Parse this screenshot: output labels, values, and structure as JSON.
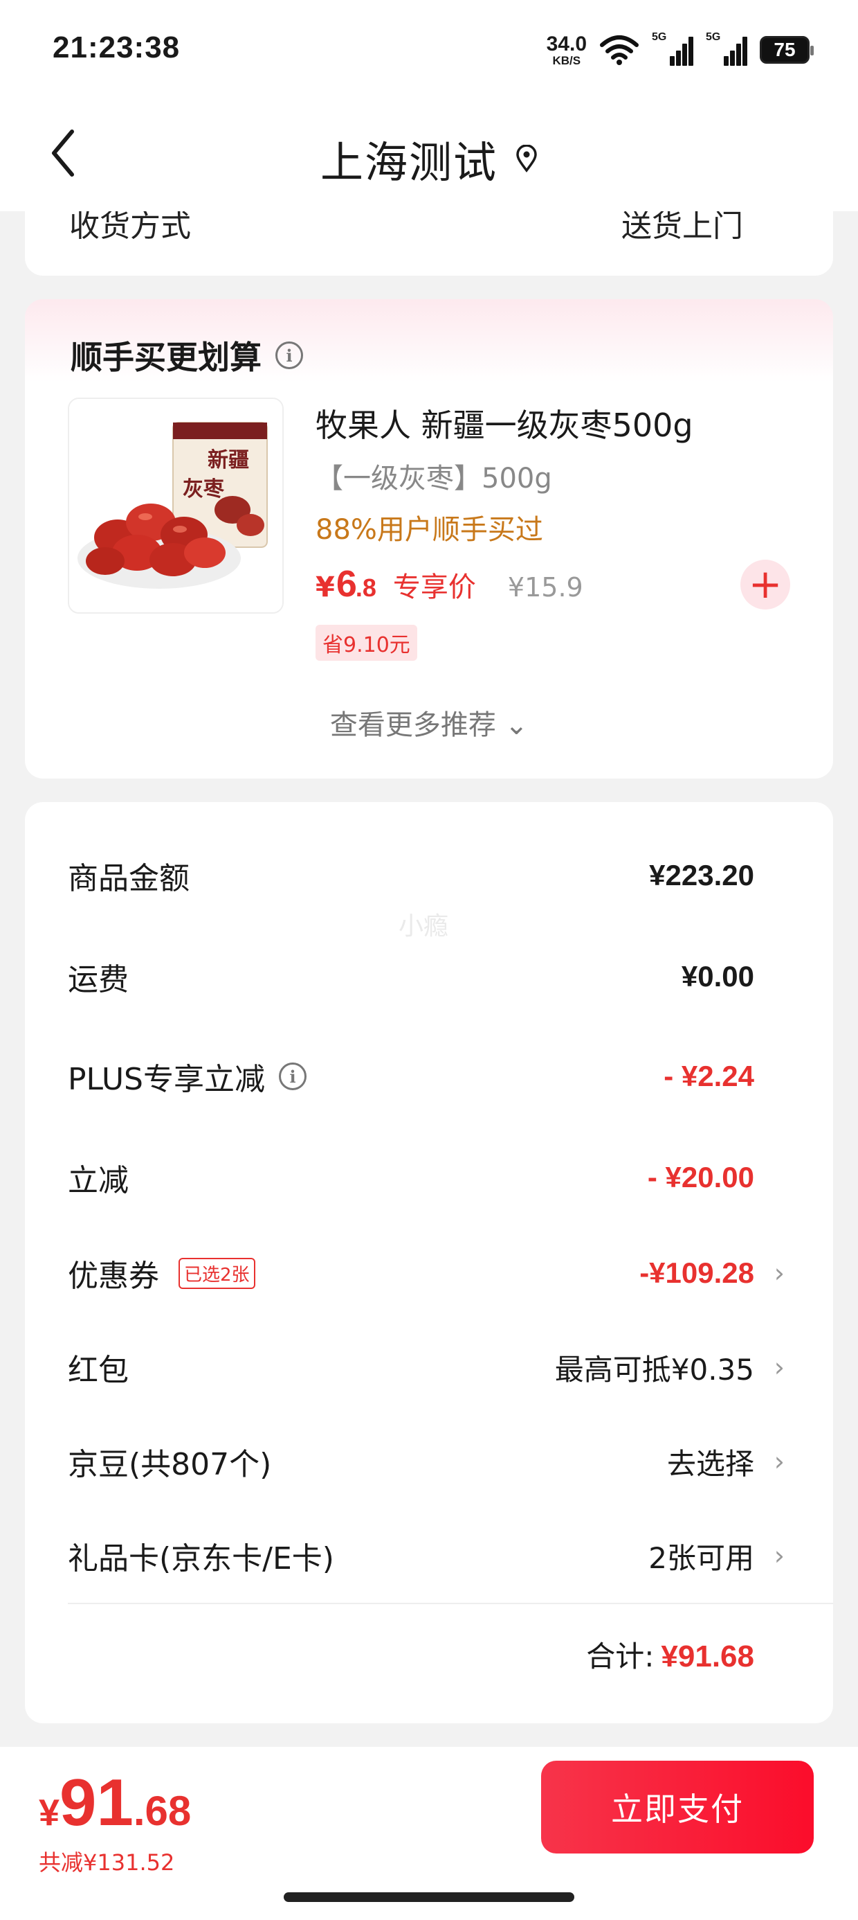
{
  "status_bar": {
    "time": "21:23:38",
    "net_speed_value": "34.0",
    "net_speed_unit": "KB/S",
    "signal1_tag": "5G",
    "signal2_tag": "5G",
    "battery": "75"
  },
  "header": {
    "title": "上海测试",
    "back_icon": "chevron-left-icon",
    "location_icon": "location-pin-icon"
  },
  "delivery": {
    "label": "收货方式",
    "value": "送货上门"
  },
  "recommend": {
    "title": "顺手买更划算",
    "product": {
      "image_text_1": "新疆",
      "image_text_2": "灰枣",
      "name": "牧果人 新疆一级灰枣500g",
      "spec": "【一级灰枣】500g",
      "bought": "88%用户顺手买过",
      "price_yen": "¥",
      "price_int": "6",
      "price_dec": ".8",
      "price_label": "专享价",
      "original_price": "¥15.9",
      "save_badge": "省9.10元"
    },
    "more": "查看更多推荐 ⌄"
  },
  "summary": {
    "watermark": "小瘾",
    "rows": [
      {
        "label": "商品金额",
        "value": "¥223.20"
      },
      {
        "label": "运费",
        "value": "¥0.00"
      },
      {
        "label": "PLUS专享立减",
        "value": "- ¥2.24"
      },
      {
        "label": "立减",
        "value": "- ¥20.00"
      },
      {
        "label": "优惠券",
        "badge": "已选2张",
        "value": "-¥109.28"
      },
      {
        "label": "红包",
        "value": "最高可抵¥0.35"
      },
      {
        "label": "京豆(共807个)",
        "value": "去选择"
      },
      {
        "label": "礼品卡(京东卡/E卡)",
        "value": "2张可用"
      }
    ],
    "total_label": "合计:",
    "total_value": "¥91.68"
  },
  "bottom": {
    "price_yen": "¥",
    "price_int": "91",
    "price_dec": ".68",
    "saved": "共减¥131.52",
    "pay_button": "立即支付"
  },
  "colors": {
    "accent_red": "#e8312f",
    "bought_orange": "#c8781a"
  }
}
